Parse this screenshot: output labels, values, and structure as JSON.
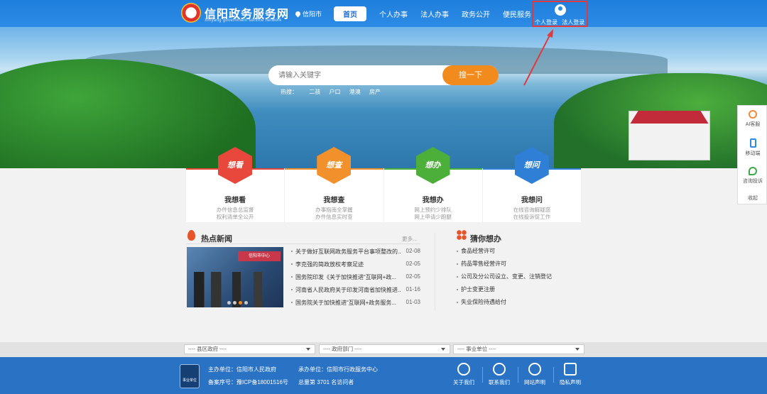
{
  "header": {
    "site_title": "信阳政务服务网",
    "site_subtitle": "Xinyang government service network",
    "city": "信阳市",
    "nav": [
      "首页",
      "个人办事",
      "法人办事",
      "政务公开",
      "便民服务"
    ],
    "login": {
      "personal": "个人登录",
      "corporate": "法人登录"
    }
  },
  "search": {
    "placeholder": "请输入关键字",
    "button": "搜一下",
    "hot_label": "热搜：",
    "hot_terms": [
      "二孩",
      "户口",
      "港澳",
      "房产"
    ]
  },
  "side_float": {
    "items": [
      "AI客服",
      "移动端",
      "咨询投诉"
    ],
    "collapse": "收起"
  },
  "cards": [
    {
      "hex": "想看",
      "title": "我想看",
      "desc1": "办件信息总监督",
      "desc2": "权利清单全公开",
      "color": "#e8473b"
    },
    {
      "hex": "想查",
      "title": "我想查",
      "desc1": "办事指南全掌握",
      "desc2": "办件信息实时查",
      "color": "#f2912b"
    },
    {
      "hex": "想办",
      "title": "我想办",
      "desc1": "网上预约少排队",
      "desc2": "网上申请少跑腿",
      "color": "#4caf3a"
    },
    {
      "hex": "想问",
      "title": "我想问",
      "desc1": "在线咨询解疑惑",
      "desc2": "在线投诉促工作",
      "color": "#2f7fd6"
    }
  ],
  "news": {
    "title": "热点新闻",
    "more": "更多...",
    "image_caption": "信阳市中心",
    "items": [
      {
        "title": "关于做好互联网政务服务平台事项整改的...",
        "date": "02-08"
      },
      {
        "title": "李克强的简政放权考察足迹",
        "date": "02-05"
      },
      {
        "title": "国务院印发《关于加快推进“互联网+政...",
        "date": "02-05"
      },
      {
        "title": "河南省人民政府关于印发河南省加快推进...",
        "date": "01-16"
      },
      {
        "title": "国务院关于加快推进“互联网+政务服务...",
        "date": "01-03"
      }
    ]
  },
  "guess": {
    "title": "猜你想办",
    "items": [
      "食品经营许可",
      "药品零售经营许可",
      "公司及分公司设立、变更、注销登记",
      "护士变更注册",
      "失业保险待遇给付"
    ]
  },
  "selects": [
    "---- 县区政府 ----",
    "---- 政府部门 ----",
    "---- 事业单位 ----"
  ],
  "footer": {
    "logo_text": "事业单位",
    "host_label": "主办单位：信阳市人民政府",
    "undertake_label": "承办单位：信阳市行政服务中心",
    "icp": "备案序号：豫ICP备18001516号",
    "visits": "总量第 3701 名访问者",
    "links": [
      "关于我们",
      "联系我们",
      "网站声明",
      "隐私声明"
    ]
  },
  "colors": {
    "header_bg": "#2b8be5",
    "search_button": "#f28b1d",
    "annotation_red": "#e23a3a",
    "footer_bg": "#2a72c4"
  }
}
